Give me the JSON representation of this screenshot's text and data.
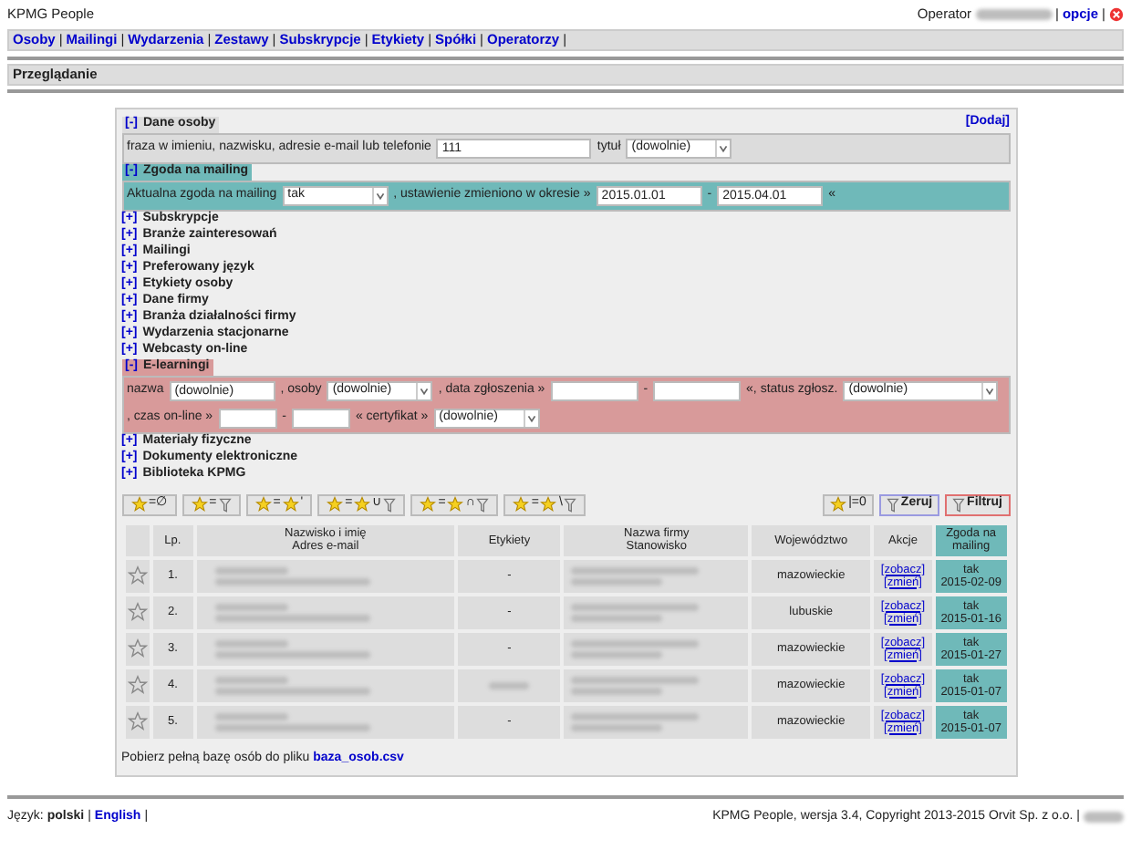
{
  "header": {
    "app_title": "KPMG People",
    "operator_label": "Operator",
    "separator": "|",
    "options_link": "opcje"
  },
  "nav": {
    "separator": "|",
    "links": [
      {
        "label": "Osoby"
      },
      {
        "label": "Mailingi"
      },
      {
        "label": "Wydarzenia"
      },
      {
        "label": "Zestawy"
      },
      {
        "label": "Subskrypcje"
      },
      {
        "label": "Etykiety"
      },
      {
        "label": "Spółki"
      },
      {
        "label": "Operatorzy"
      }
    ]
  },
  "page_title": "Przeglądanie",
  "add_link": "[Dodaj]",
  "sections": [
    {
      "toggle": "[-]",
      "title": "Dane osoby",
      "expanded": true,
      "color": "#dcdcdc",
      "parts": [
        {
          "kind": "text",
          "text": "fraza w imieniu, nazwisku, adresie e-mail lub telefonie"
        },
        {
          "kind": "input",
          "value": "111"
        },
        {
          "kind": "text",
          "text": "tytuł"
        },
        {
          "kind": "select",
          "value": "(dowolnie)"
        }
      ]
    },
    {
      "toggle": "[-]",
      "title": "Zgoda na mailing",
      "expanded": true,
      "color": "#6fb9b9",
      "parts": [
        {
          "kind": "text",
          "text": "Aktualna zgoda na mailing"
        },
        {
          "kind": "select",
          "value": "tak"
        },
        {
          "kind": "text",
          "text": ", ustawienie zmieniono w okresie »"
        },
        {
          "kind": "input",
          "value": "2015.01.01"
        },
        {
          "kind": "text",
          "text": "-"
        },
        {
          "kind": "input",
          "value": "2015.04.01"
        },
        {
          "kind": "text",
          "text": "«"
        }
      ]
    },
    {
      "toggle": "[+]",
      "title": "Subskrypcje",
      "expanded": false
    },
    {
      "toggle": "[+]",
      "title": "Branże zainteresowań",
      "expanded": false
    },
    {
      "toggle": "[+]",
      "title": "Mailingi",
      "expanded": false
    },
    {
      "toggle": "[+]",
      "title": "Preferowany język",
      "expanded": false
    },
    {
      "toggle": "[+]",
      "title": "Etykiety osoby",
      "expanded": false
    },
    {
      "toggle": "[+]",
      "title": "Dane firmy",
      "expanded": false
    },
    {
      "toggle": "[+]",
      "title": "Branża działalności firmy",
      "expanded": false
    },
    {
      "toggle": "[+]",
      "title": "Wydarzenia stacjonarne",
      "expanded": false
    },
    {
      "toggle": "[+]",
      "title": "Webcasty on-line",
      "expanded": false
    },
    {
      "toggle": "[-]",
      "title": "E-learningi",
      "expanded": true,
      "color": "#d89a9a",
      "parts": [
        {
          "kind": "text",
          "text": "nazwa"
        },
        {
          "kind": "input",
          "value": "(dowolnie)"
        },
        {
          "kind": "text",
          "text": ", osoby"
        },
        {
          "kind": "select",
          "value": "(dowolnie)"
        },
        {
          "kind": "text",
          "text": ", data zgłoszenia »"
        },
        {
          "kind": "input"
        },
        {
          "kind": "text",
          "text": "-"
        },
        {
          "kind": "input"
        },
        {
          "kind": "text",
          "text": "«, status zgłosz."
        },
        {
          "kind": "select",
          "value": "(dowolnie)"
        },
        {
          "kind": "text",
          "text": ", czas on-line »"
        },
        {
          "kind": "input"
        },
        {
          "kind": "text",
          "text": "-"
        },
        {
          "kind": "input"
        },
        {
          "kind": "text",
          "text": "« certyfikat »"
        },
        {
          "kind": "select",
          "value": "(dowolnie)"
        }
      ]
    },
    {
      "toggle": "[+]",
      "title": "Materiały fizyczne",
      "expanded": false
    },
    {
      "toggle": "[+]",
      "title": "Dokumenty elektroniczne",
      "expanded": false
    },
    {
      "toggle": "[+]",
      "title": "Biblioteka KPMG",
      "expanded": false
    }
  ],
  "set_buttons": [
    {
      "parts": [
        {
          "kind": "star"
        },
        {
          "kind": "text",
          "text": "=∅"
        }
      ]
    },
    {
      "parts": [
        {
          "kind": "star"
        },
        {
          "kind": "text",
          "text": "="
        },
        {
          "kind": "filter"
        }
      ]
    },
    {
      "parts": [
        {
          "kind": "star"
        },
        {
          "kind": "text",
          "text": "="
        },
        {
          "kind": "star"
        },
        {
          "kind": "text",
          "text": "'"
        }
      ]
    },
    {
      "parts": [
        {
          "kind": "star"
        },
        {
          "kind": "text",
          "text": "="
        },
        {
          "kind": "star"
        },
        {
          "kind": "text",
          "text": "∪"
        },
        {
          "kind": "filter"
        }
      ]
    },
    {
      "parts": [
        {
          "kind": "star"
        },
        {
          "kind": "text",
          "text": "="
        },
        {
          "kind": "star"
        },
        {
          "kind": "text",
          "text": "∩"
        },
        {
          "kind": "filter"
        }
      ]
    },
    {
      "parts": [
        {
          "kind": "star"
        },
        {
          "kind": "text",
          "text": "="
        },
        {
          "kind": "star"
        },
        {
          "kind": "text",
          "text": "\\"
        },
        {
          "kind": "filter"
        }
      ]
    }
  ],
  "count_button": {
    "text": "|=0"
  },
  "reset_button": {
    "label": "Zeruj"
  },
  "filter_button": {
    "label": "Filtruj"
  },
  "table": {
    "columns": [
      {},
      {
        "label": "Lp."
      },
      {
        "label": "Nazwisko i imię\nAdres e-mail"
      },
      {
        "label": "Etykiety"
      },
      {
        "label": "Nazwa firmy\nStanowisko"
      },
      {
        "label": "Województwo"
      },
      {
        "label": "Akcje"
      },
      {
        "label": "Zgoda na\nmailing"
      }
    ],
    "rows": [
      {
        "lp": "1.",
        "labels": "-",
        "labels_blurred": false,
        "region": "mazowieckie",
        "actions": [
          "[zobacz]",
          "[zmień]"
        ],
        "consent": "tak",
        "consent_date": "2015-02-09"
      },
      {
        "lp": "2.",
        "labels": "-",
        "labels_blurred": false,
        "region": "lubuskie",
        "actions": [
          "[zobacz]",
          "[zmień]"
        ],
        "consent": "tak",
        "consent_date": "2015-01-16"
      },
      {
        "lp": "3.",
        "labels": "-",
        "labels_blurred": false,
        "region": "mazowieckie",
        "actions": [
          "[zobacz]",
          "[zmień]"
        ],
        "consent": "tak",
        "consent_date": "2015-01-27"
      },
      {
        "lp": "4.",
        "labels_blurred": true,
        "region": "mazowieckie",
        "actions": [
          "[zobacz]",
          "[zmień]"
        ],
        "consent": "tak",
        "consent_date": "2015-01-07"
      },
      {
        "lp": "5.",
        "labels": "-",
        "labels_blurred": false,
        "region": "mazowieckie",
        "actions": [
          "[zobacz]",
          "[zmień]"
        ],
        "consent": "tak",
        "consent_date": "2015-01-07"
      }
    ]
  },
  "download": {
    "text": "Pobierz pełną bazę osób do pliku",
    "link": "baza_osob.csv"
  },
  "footer": {
    "language_label": "Język:",
    "current_language": "polski",
    "separator": "|",
    "other_language": "English",
    "copyright": "KPMG People, wersja 3.4, Copyright 2013-2015 Orvit Sp. z o.o. |"
  }
}
